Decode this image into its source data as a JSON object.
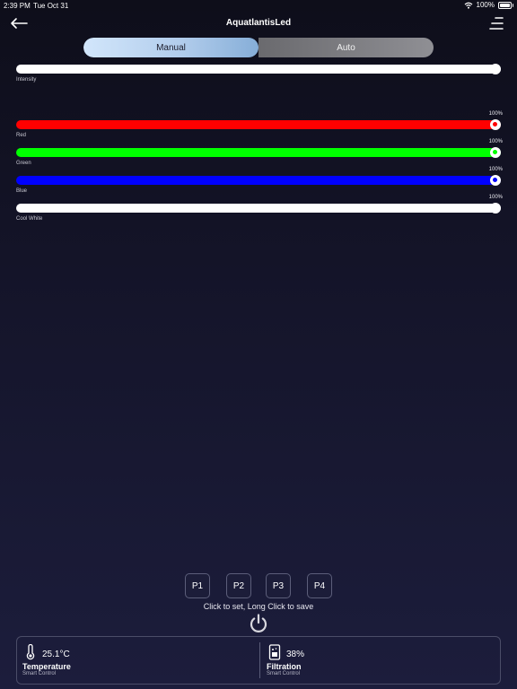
{
  "status": {
    "time": "2:39 PM",
    "date": "Tue Oct 31",
    "battery": "100%"
  },
  "header": {
    "title": "AquatlantisLed"
  },
  "mode": {
    "options": [
      "Manual",
      "Auto"
    ],
    "selected": "Manual"
  },
  "intensity": {
    "label": "Intensity",
    "value_percent": 100
  },
  "channels": [
    {
      "label": "Red",
      "value": "100%",
      "value_percent": 100,
      "color": "#ff0000"
    },
    {
      "label": "Green",
      "value": "100%",
      "value_percent": 100,
      "color": "#00ff00"
    },
    {
      "label": "Blue",
      "value": "100%",
      "value_percent": 100,
      "color": "#0000ff"
    },
    {
      "label": "Cool White",
      "value": "100%",
      "value_percent": 100,
      "color": "#ffffff"
    }
  ],
  "presets": {
    "buttons": [
      "P1",
      "P2",
      "P3",
      "P4"
    ],
    "hint": "Click to set, Long Click to save"
  },
  "smart": {
    "temperature": {
      "value": "25.1°C",
      "name": "Temperature",
      "sub": "Smart Control"
    },
    "filtration": {
      "value": "38%",
      "name": "Filtration",
      "sub": "Smart Control"
    }
  }
}
